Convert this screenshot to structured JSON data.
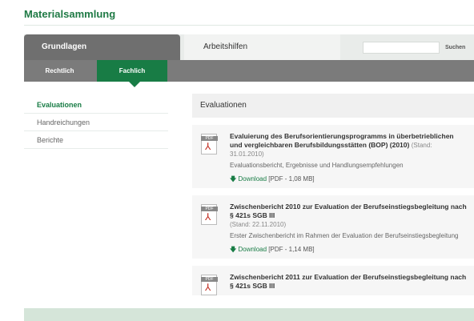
{
  "page": {
    "title": "Materialsammlung"
  },
  "tabs": {
    "grundlagen": "Grundlagen",
    "arbeitshilfen": "Arbeitshilfen"
  },
  "search": {
    "button": "Suchen",
    "placeholder": ""
  },
  "subnav": {
    "rechtlich": "Rechtlich",
    "fachlich": "Fachlich"
  },
  "sidebar": {
    "items": [
      {
        "label": "Evaluationen"
      },
      {
        "label": "Handreichungen"
      },
      {
        "label": "Berichte"
      }
    ]
  },
  "content": {
    "header": "Evaluationen",
    "entries": [
      {
        "title": "Evaluierung des Berufsorientierungsprogramms in überbetrieblichen und vergleichbaren Berufsbildungsstätten (BOP) (2010)",
        "stand": "(Stand: 31.01.2010)",
        "desc": "Evaluationsbericht, Ergebnisse und Handlungsempfehlungen",
        "download_label": "Download",
        "file": "[PDF - 1,08 MB]"
      },
      {
        "title": "Zwischenbericht 2010 zur Evaluation der Berufseinstiegsbegleitung nach § 421s SGB III",
        "stand": "(Stand: 22.11.2010)",
        "desc": "Erster Zwischenbericht im Rahmen der Evaluation der Berufseinstiegsbegleitung",
        "download_label": "Download",
        "file": "[PDF - 1,14 MB]"
      },
      {
        "title": "Zwischenbericht 2011 zur Evaluation der Berufseinstiegsbegleitung nach § 421s SGB III"
      }
    ]
  }
}
